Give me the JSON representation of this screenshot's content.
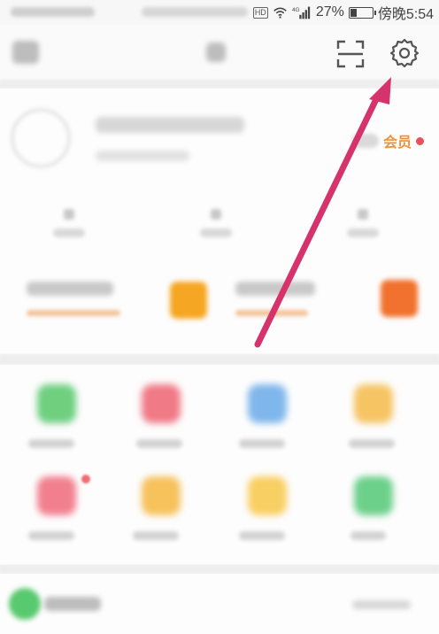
{
  "status_bar": {
    "network_badge": "HD",
    "signal_label": "4G",
    "battery_percent": "27%",
    "battery_level": 0.27,
    "time": "傍晚5:54"
  },
  "header": {
    "icons": [
      "user-settings-icon",
      "message-icon",
      "scan-icon",
      "gear-icon"
    ]
  },
  "profile": {
    "member_label": "会员"
  },
  "colors": {
    "accent_orange": "#f0923a",
    "red_dot": "#e8505b",
    "arrow": "#d6336c"
  }
}
